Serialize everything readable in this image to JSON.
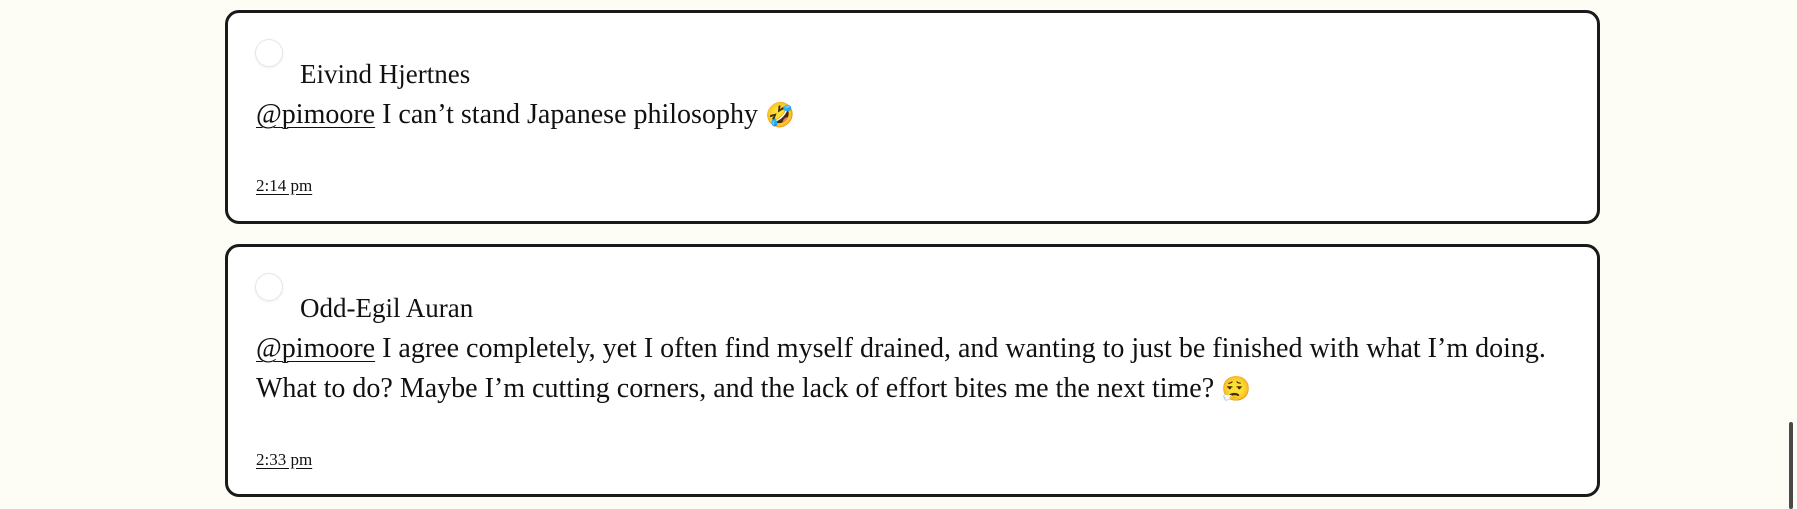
{
  "replies": [
    {
      "author": "Eivind Hjertnes",
      "mention": "@pimoore",
      "text": "I can’t stand Japanese philosophy",
      "emoji": "🤣",
      "timestamp": "2:14 pm"
    },
    {
      "author": "Odd-Egil Auran",
      "mention": "@pimoore",
      "text": "I agree completely, yet I often find myself drained, and wanting to just be finished with what I’m doing. What to do? Maybe I’m cutting corners, and the lack of effort bites me the next time?",
      "emoji": "😮‍💨",
      "timestamp": "2:33 pm"
    }
  ]
}
